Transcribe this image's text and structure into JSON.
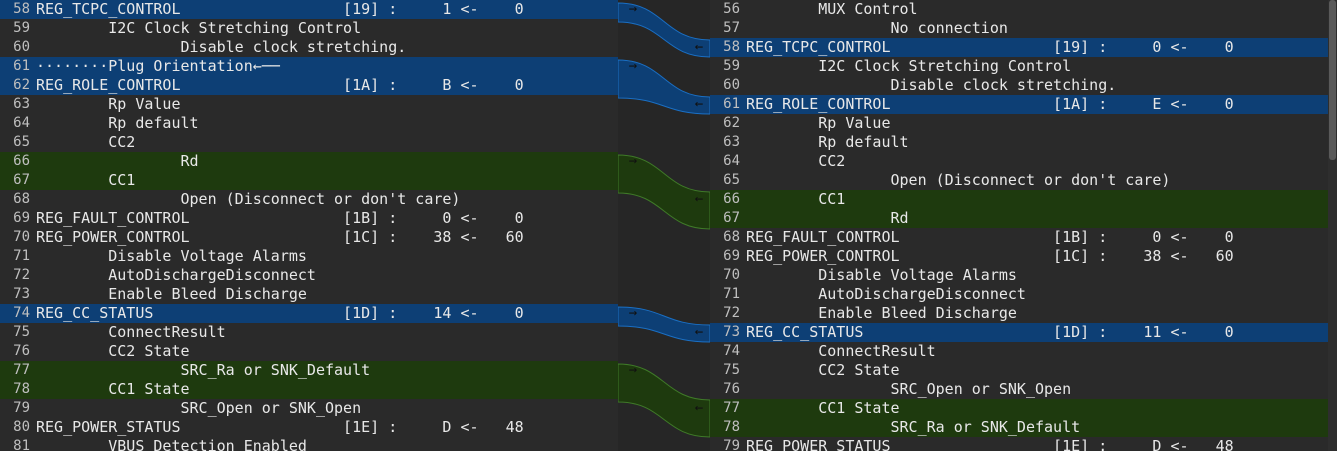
{
  "left_lines": [
    {
      "num": "58",
      "text": "REG_TCPC_CONTROL                  [19] :     1 <-    0",
      "bg": "blue",
      "arrow": "→",
      "hl": "1"
    },
    {
      "num": "59",
      "text": "        I2C Clock Stretching Control",
      "bg": ""
    },
    {
      "num": "60",
      "text": "                Disable clock stretching.",
      "bg": ""
    },
    {
      "num": "61",
      "text": "········Plug Orientation←──",
      "bg": "blue",
      "arrow": "→"
    },
    {
      "num": "62",
      "text": "REG_ROLE_CONTROL                  [1A] :     B <-    0",
      "bg": "blue",
      "hl": "B"
    },
    {
      "num": "63",
      "text": "        Rp Value",
      "bg": ""
    },
    {
      "num": "64",
      "text": "        Rp default",
      "bg": ""
    },
    {
      "num": "65",
      "text": "        CC2",
      "bg": ""
    },
    {
      "num": "66",
      "text": "                Rd",
      "bg": "green",
      "arrow": "→"
    },
    {
      "num": "67",
      "text": "        CC1",
      "bg": "green"
    },
    {
      "num": "68",
      "text": "                Open (Disconnect or don't care)",
      "bg": ""
    },
    {
      "num": "69",
      "text": "REG_FAULT_CONTROL                 [1B] :     0 <-    0",
      "bg": ""
    },
    {
      "num": "70",
      "text": "REG_POWER_CONTROL                 [1C] :    38 <-   60",
      "bg": ""
    },
    {
      "num": "71",
      "text": "        Disable Voltage Alarms",
      "bg": ""
    },
    {
      "num": "72",
      "text": "        AutoDischargeDisconnect",
      "bg": ""
    },
    {
      "num": "73",
      "text": "        Enable Bleed Discharge",
      "bg": ""
    },
    {
      "num": "74",
      "text": "REG_CC_STATUS                     [1D] :    14 <-    0",
      "bg": "blue",
      "arrow": "→",
      "hl": "14"
    },
    {
      "num": "75",
      "text": "        ConnectResult",
      "bg": ""
    },
    {
      "num": "76",
      "text": "        CC2 State",
      "bg": ""
    },
    {
      "num": "77",
      "text": "                SRC_Ra or SNK_Default",
      "bg": "green",
      "arrow": "→"
    },
    {
      "num": "78",
      "text": "        CC1 State",
      "bg": "green"
    },
    {
      "num": "79",
      "text": "                SRC_Open or SNK_Open",
      "bg": ""
    },
    {
      "num": "80",
      "text": "REG_POWER_STATUS                  [1E] :     D <-   48",
      "bg": ""
    },
    {
      "num": "81",
      "text": "        VBUS Detection Enabled",
      "bg": ""
    }
  ],
  "right_lines": [
    {
      "num": "56",
      "text": "        MUX Control",
      "bg": ""
    },
    {
      "num": "57",
      "text": "                No connection",
      "bg": ""
    },
    {
      "num": "58",
      "text": "REG_TCPC_CONTROL                  [19] :     0 <-    0",
      "bg": "blue",
      "arrow": "←",
      "hl": "0"
    },
    {
      "num": "59",
      "text": "        I2C Clock Stretching Control",
      "bg": ""
    },
    {
      "num": "60",
      "text": "                Disable clock stretching.",
      "bg": ""
    },
    {
      "num": "61",
      "text": "REG_ROLE_CONTROL                  [1A] :     E <-    0",
      "bg": "blue",
      "arrow": "←",
      "hl": "E"
    },
    {
      "num": "62",
      "text": "        Rp Value",
      "bg": ""
    },
    {
      "num": "63",
      "text": "        Rp default",
      "bg": ""
    },
    {
      "num": "64",
      "text": "        CC2",
      "bg": ""
    },
    {
      "num": "65",
      "text": "                Open (Disconnect or don't care)",
      "bg": ""
    },
    {
      "num": "66",
      "text": "        CC1",
      "bg": "green",
      "arrow": "←"
    },
    {
      "num": "67",
      "text": "                Rd",
      "bg": "green"
    },
    {
      "num": "68",
      "text": "REG_FAULT_CONTROL                 [1B] :     0 <-    0",
      "bg": ""
    },
    {
      "num": "69",
      "text": "REG_POWER_CONTROL                 [1C] :    38 <-   60",
      "bg": ""
    },
    {
      "num": "70",
      "text": "        Disable Voltage Alarms",
      "bg": ""
    },
    {
      "num": "71",
      "text": "        AutoDischargeDisconnect",
      "bg": ""
    },
    {
      "num": "72",
      "text": "        Enable Bleed Discharge",
      "bg": ""
    },
    {
      "num": "73",
      "text": "REG_CC_STATUS                     [1D] :    11 <-    0",
      "bg": "blue",
      "arrow": "←",
      "hl": "11"
    },
    {
      "num": "74",
      "text": "        ConnectResult",
      "bg": ""
    },
    {
      "num": "75",
      "text": "        CC2 State",
      "bg": ""
    },
    {
      "num": "76",
      "text": "                SRC_Open or SNK_Open",
      "bg": ""
    },
    {
      "num": "77",
      "text": "        CC1 State",
      "bg": "green",
      "arrow": "←"
    },
    {
      "num": "78",
      "text": "                SRC_Ra or SNK_Default",
      "bg": "green"
    },
    {
      "num": "79",
      "text": "REG_POWER_STATUS                  [1E] :     D <-   48",
      "bg": ""
    }
  ],
  "colors": {
    "changed_blue": "#0d3f75",
    "changed_green": "#1e3a0e",
    "connector_blue": "#0d3f75",
    "connector_green": "#1e3a0e"
  },
  "icons": {
    "push_right": "arrow-right-icon",
    "push_left": "arrow-left-icon"
  }
}
